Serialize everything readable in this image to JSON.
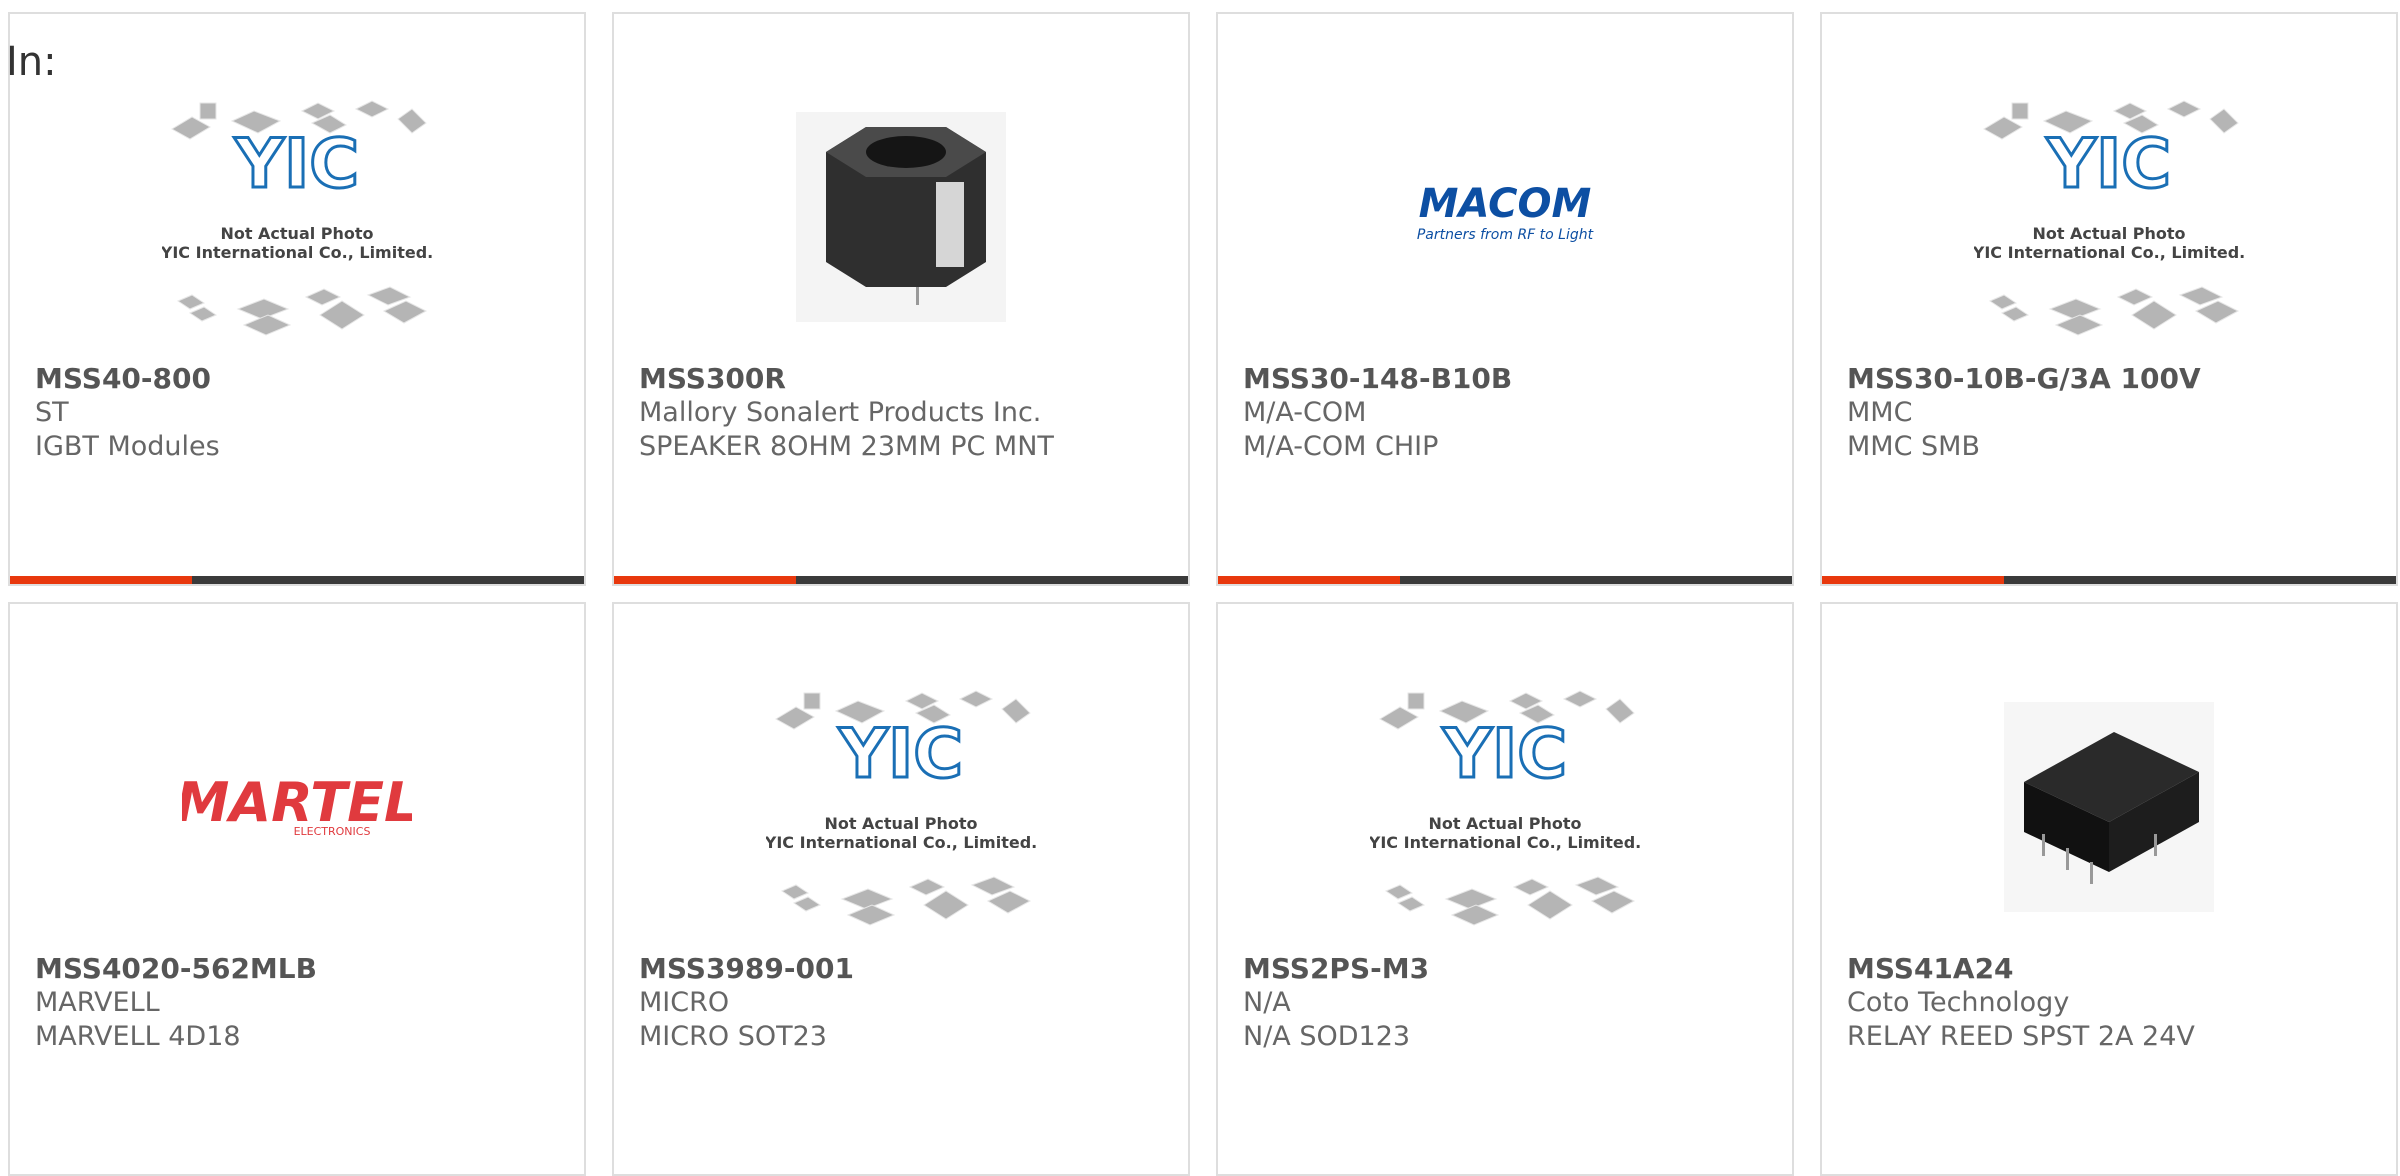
{
  "header": {
    "in_label": "In:"
  },
  "placeholder": {
    "line1": "Not Actual Photo",
    "line2": "YIC International Co., Limited.",
    "logo": "YIC"
  },
  "logos": {
    "macom_name": "MACOM",
    "macom_tag": "Partners from RF to Light",
    "martel_name": "MARTEL",
    "martel_sub": "ELECTRONICS"
  },
  "colors": {
    "accent": "#e8380d",
    "bar": "#3a3a3a",
    "yic_blue": "#1a6fb5",
    "martel_red": "#e03a3e",
    "macom_blue": "#0d4fa3"
  },
  "products": [
    {
      "part": "MSS40-800",
      "maker": "ST",
      "desc": "IGBT Modules",
      "image": "yic-placeholder"
    },
    {
      "part": "MSS300R",
      "maker": "Mallory Sonalert Products Inc.",
      "desc": "SPEAKER 8OHM 23MM PC MNT",
      "image": "speaker-photo"
    },
    {
      "part": "MSS30-148-B10B",
      "maker": "M/A-COM",
      "desc": "M/A-COM CHIP",
      "image": "macom-logo"
    },
    {
      "part": "MSS30-10B-G/3A 100V",
      "maker": "MMC",
      "desc": "MMC SMB",
      "image": "yic-placeholder"
    },
    {
      "part": "MSS4020-562MLB",
      "maker": "MARVELL",
      "desc": "MARVELL 4D18",
      "image": "martel-logo"
    },
    {
      "part": "MSS3989-001",
      "maker": "MICRO",
      "desc": "MICRO SOT23",
      "image": "yic-placeholder"
    },
    {
      "part": "MSS2PS-M3",
      "maker": "N/A",
      "desc": "N/A SOD123",
      "image": "yic-placeholder"
    },
    {
      "part": "MSS41A24",
      "maker": "Coto Technology",
      "desc": "RELAY REED SPST 2A 24V",
      "image": "relay-photo"
    }
  ]
}
